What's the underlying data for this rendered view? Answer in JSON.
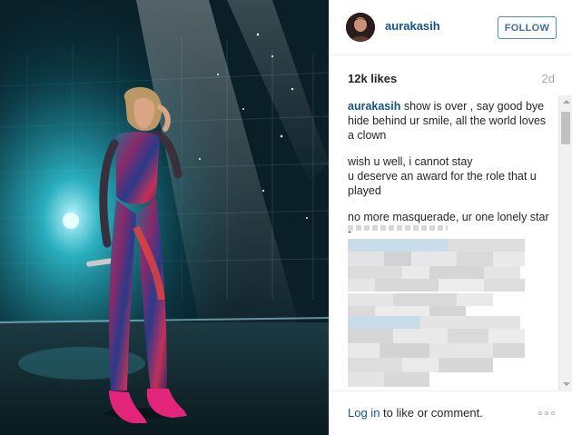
{
  "post": {
    "photo_alt": "Performer on stage",
    "username": "aurakasih",
    "follow_label": "FOLLOW",
    "likes": "12k likes",
    "age": "2d"
  },
  "caption": {
    "user": "aurakasih",
    "line1": "show is over , say good bye hide behind ur smile, all the world loves a clown",
    "line2": "wish u well, i cannot stay\nu deserve an award for the role that u played",
    "line3": "no more masquerade, ur one lonely star -"
  },
  "footer": {
    "login_link": "Log in",
    "login_rest": " to like or comment."
  },
  "colors": {
    "link_blue": "#125688",
    "follow_border": "#4b8bbe",
    "muted_gray": "#a5a7aa"
  },
  "icons": {
    "more": "ellipsis-icon"
  }
}
